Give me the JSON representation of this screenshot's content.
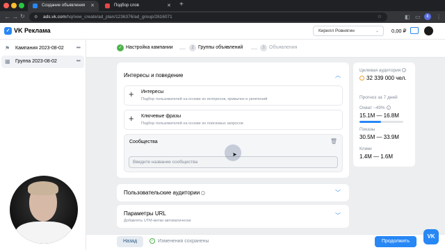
{
  "browser": {
    "tabs": [
      {
        "title": "Создание объявления",
        "active": true,
        "favicon_color": "#2787f5"
      },
      {
        "title": "Подбор слов",
        "active": false,
        "favicon_color": "#e64646"
      }
    ],
    "new_tab_icon": "plus-icon",
    "url_host": "ads.vk.com",
    "url_path": "/hq/new_create/ad_plan/1236376/ad_group/2616071",
    "profile_letter": "k"
  },
  "header": {
    "brand": "VK Реклама",
    "account_name": "Кирилл Ровнягин",
    "balance": "0,00 ₽"
  },
  "sidebar": {
    "items": [
      {
        "label": "Кампания 2023-08-02",
        "icon": "flag-icon",
        "active": false
      },
      {
        "label": "Группа 2023-08-02",
        "icon": "grid-icon",
        "active": true
      }
    ]
  },
  "steps": [
    {
      "num": "✓",
      "label": "Настройка кампании",
      "state": "done"
    },
    {
      "num": "2",
      "label": "Группы объявлений",
      "state": "current"
    },
    {
      "num": "3",
      "label": "Объявления",
      "state": "disabled"
    }
  ],
  "interests": {
    "title": "Интересы и поведение",
    "options": [
      {
        "title": "Интересы",
        "subtitle": "Подбор пользователей на основе их интересов, привычек и увлечений"
      },
      {
        "title": "Ключевые фразы",
        "subtitle": "Подбор пользователей на основе их поисковых запросов"
      }
    ],
    "communities": {
      "title": "Сообщества",
      "placeholder": "Введите название сообщества"
    }
  },
  "user_audiences": {
    "title": "Пользовательские аудитории"
  },
  "utm": {
    "title": "Параметры URL",
    "subtitle": "Добавлять UTM-метки автоматически"
  },
  "forecast": {
    "audience_label": "Целевая аудитория",
    "audience_value": "32 339 000 чел.",
    "period_label": "Прогноз за 7 дней",
    "reach_label": "Охват ~49%",
    "reach_value": "15.1M — 16.8M",
    "reach_fraction": 0.49,
    "impressions_label": "Показы",
    "impressions_value": "30.5M — 33.9M",
    "clicks_label": "Клики",
    "clicks_value": "1.4M — 1.6M"
  },
  "footer": {
    "back_label": "Назад",
    "saved_label": "Изменения сохранены",
    "next_label": "Продолжить"
  },
  "colors": {
    "accent": "#2787f5",
    "success": "#4bb34b"
  }
}
